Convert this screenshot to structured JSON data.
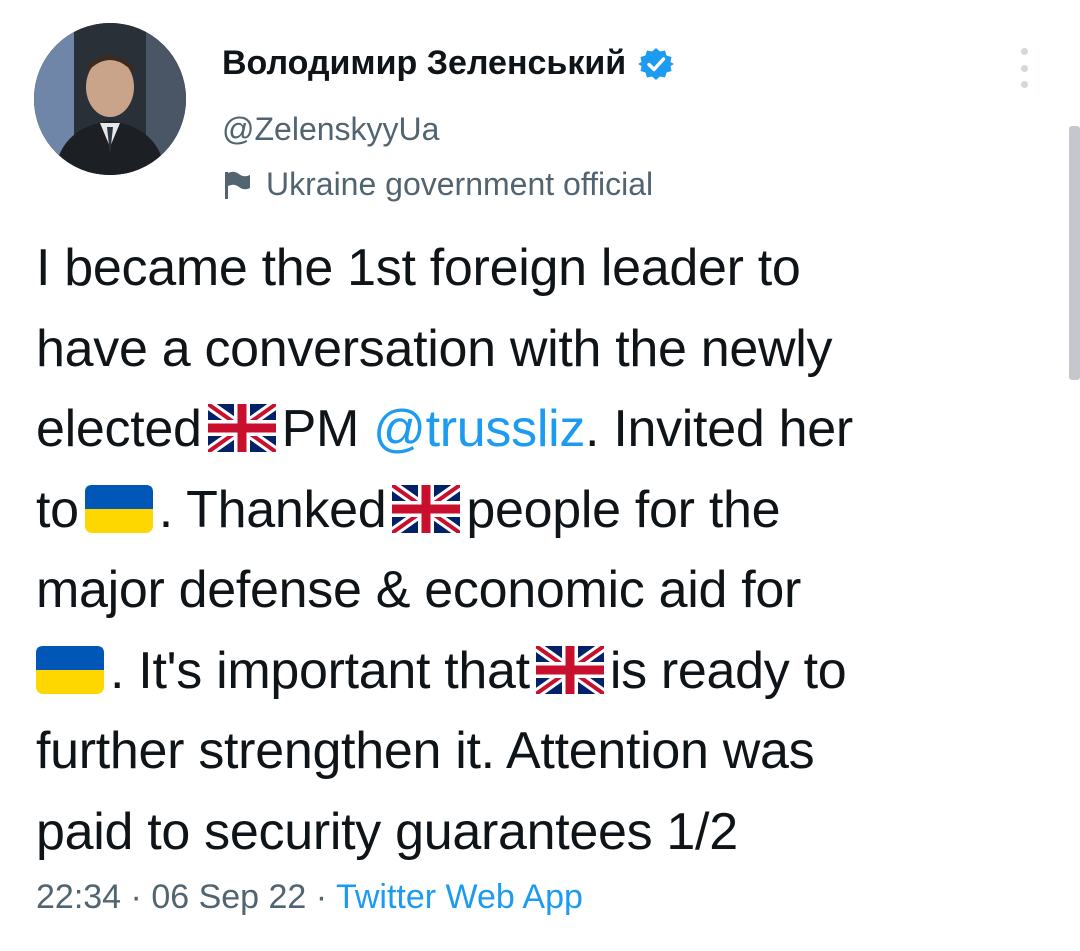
{
  "author": {
    "display_name": "Володимир Зеленський",
    "handle": "@ZelenskyyUa",
    "affiliation": "Ukraine government official",
    "verified_icon": "verified-badge-icon",
    "affiliation_icon": "flag-icon"
  },
  "tweet": {
    "line1": "I became the 1st foreign leader to",
    "line2": "have a conversation with the newly",
    "line3_a": "elected",
    "line3_b": "PM",
    "mention": "@trussliz",
    "line3_c": ". Invited her",
    "line4_a": "to",
    "line4_b": ". Thanked",
    "line4_c": "people for the",
    "line5": "major defense & economic aid for",
    "line6_a": ". It's important that",
    "line6_b": "is ready to",
    "line7": "further strengthen it. Attention was",
    "line8": "paid to security guarantees 1/2"
  },
  "meta": {
    "time": "22:34",
    "sep1": " · ",
    "date": "06 Sep 22",
    "sep2": " · ",
    "source": "Twitter Web App"
  },
  "colors": {
    "link": "#1d9bf0",
    "secondary_text": "#536471",
    "ua_blue": "#0057b7",
    "ua_yellow": "#ffd700",
    "uk_blue": "#012169",
    "uk_red": "#c8102e"
  }
}
